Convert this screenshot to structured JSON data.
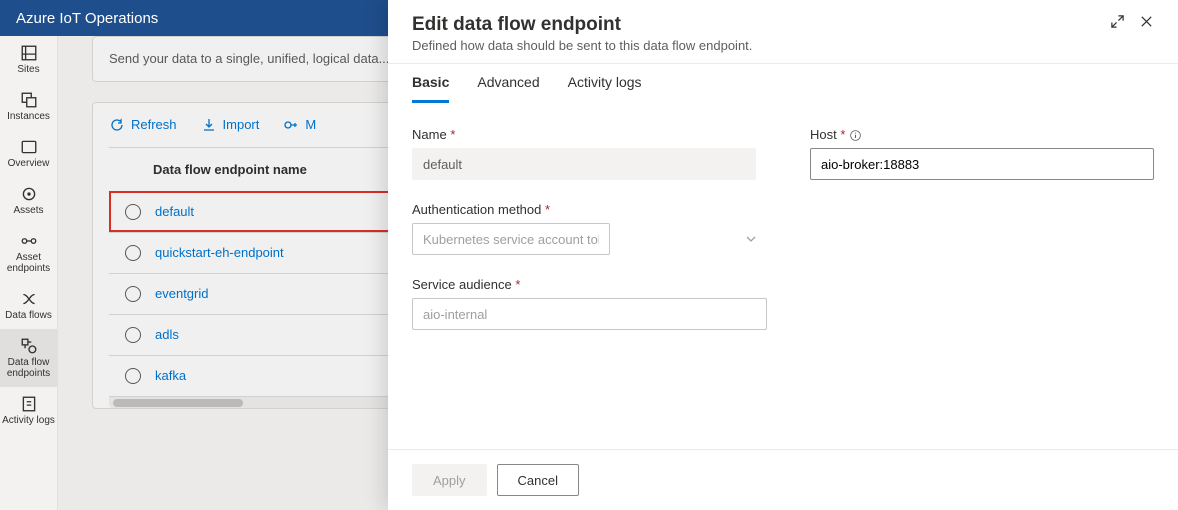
{
  "app_title": "Azure IoT Operations",
  "nav": {
    "items": [
      {
        "label": "Sites"
      },
      {
        "label": "Instances"
      },
      {
        "label": "Overview"
      },
      {
        "label": "Assets"
      },
      {
        "label": "Asset endpoints"
      },
      {
        "label": "Data flows"
      },
      {
        "label": "Data flow endpoints"
      },
      {
        "label": "Activity logs"
      }
    ]
  },
  "info_card": "Send your data to a single, unified, logical data... designed to be the central hub for all your data...",
  "toolbar": {
    "refresh": "Refresh",
    "import": "Import",
    "more": "M"
  },
  "table": {
    "header": "Data flow endpoint name",
    "rows": [
      {
        "name": "default",
        "highlight": true
      },
      {
        "name": "quickstart-eh-endpoint"
      },
      {
        "name": "eventgrid"
      },
      {
        "name": "adls"
      },
      {
        "name": "kafka"
      }
    ]
  },
  "panel": {
    "title": "Edit data flow endpoint",
    "subtitle": "Defined how data should be sent to this data flow endpoint.",
    "tabs": [
      {
        "label": "Basic",
        "active": true
      },
      {
        "label": "Advanced"
      },
      {
        "label": "Activity logs"
      }
    ],
    "form": {
      "name_label": "Name",
      "name_value": "default",
      "host_label": "Host",
      "host_value": "aio-broker:18883",
      "auth_label": "Authentication method",
      "auth_value": "Kubernetes service account token",
      "audience_label": "Service audience",
      "audience_value": "aio-internal"
    },
    "footer": {
      "apply": "Apply",
      "cancel": "Cancel"
    }
  }
}
